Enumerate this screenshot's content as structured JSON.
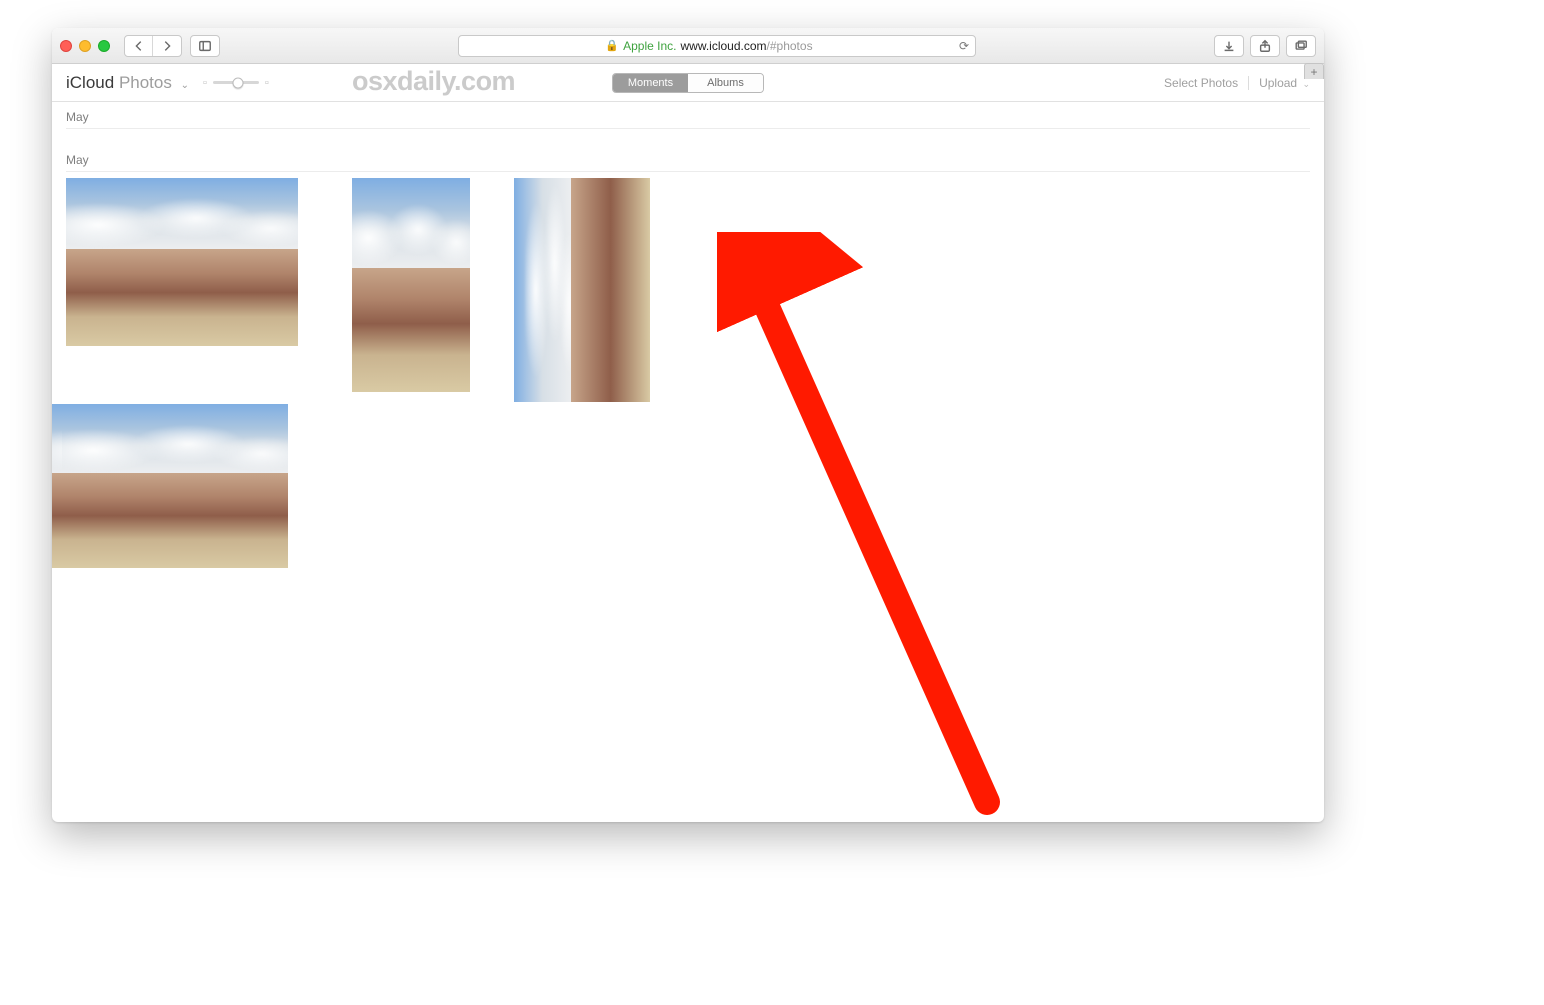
{
  "browser": {
    "address": {
      "company": "Apple Inc.",
      "domain": "www.icloud.com",
      "path": "/#photos"
    }
  },
  "app": {
    "brand_main": "iCloud",
    "brand_sub": "Photos",
    "watermark": "osxdaily.com",
    "tabs": {
      "moments": "Moments",
      "albums": "Albums"
    },
    "actions": {
      "select": "Select Photos",
      "upload": "Upload"
    }
  },
  "sections": [
    {
      "title": "May",
      "thumbs": [
        "land",
        "land",
        "land"
      ]
    },
    {
      "title": "May",
      "thumbs": [
        "land2",
        "port",
        "port2_rot"
      ]
    }
  ]
}
